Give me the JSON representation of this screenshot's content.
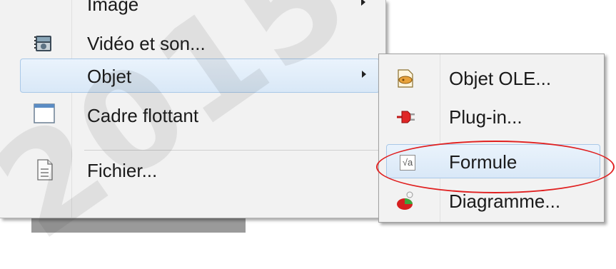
{
  "main_menu": {
    "items": [
      {
        "label": "Image",
        "has_submenu": true,
        "icon": "image-icon"
      },
      {
        "label": "Vidéo et son...",
        "icon": "film-icon"
      },
      {
        "label": "Objet",
        "has_submenu": true,
        "hovered": true
      },
      {
        "label": "Cadre flottant",
        "icon": "window-frame-icon"
      },
      {
        "label": "Fichier...",
        "icon": "document-icon"
      }
    ]
  },
  "submenu": {
    "items": [
      {
        "label": "Objet OLE...",
        "icon": "ole-object-icon"
      },
      {
        "label": "Plug-in...",
        "icon": "plug-icon"
      },
      {
        "label": "Formule",
        "icon": "formula-sqrt-icon",
        "hovered": true,
        "highlighted": true
      },
      {
        "label": "Diagramme...",
        "icon": "chart-icon"
      }
    ]
  },
  "colors": {
    "highlight_ring": "#e02020",
    "hover_bg": "#d9e8f7",
    "menu_bg": "#f2f2f2"
  }
}
